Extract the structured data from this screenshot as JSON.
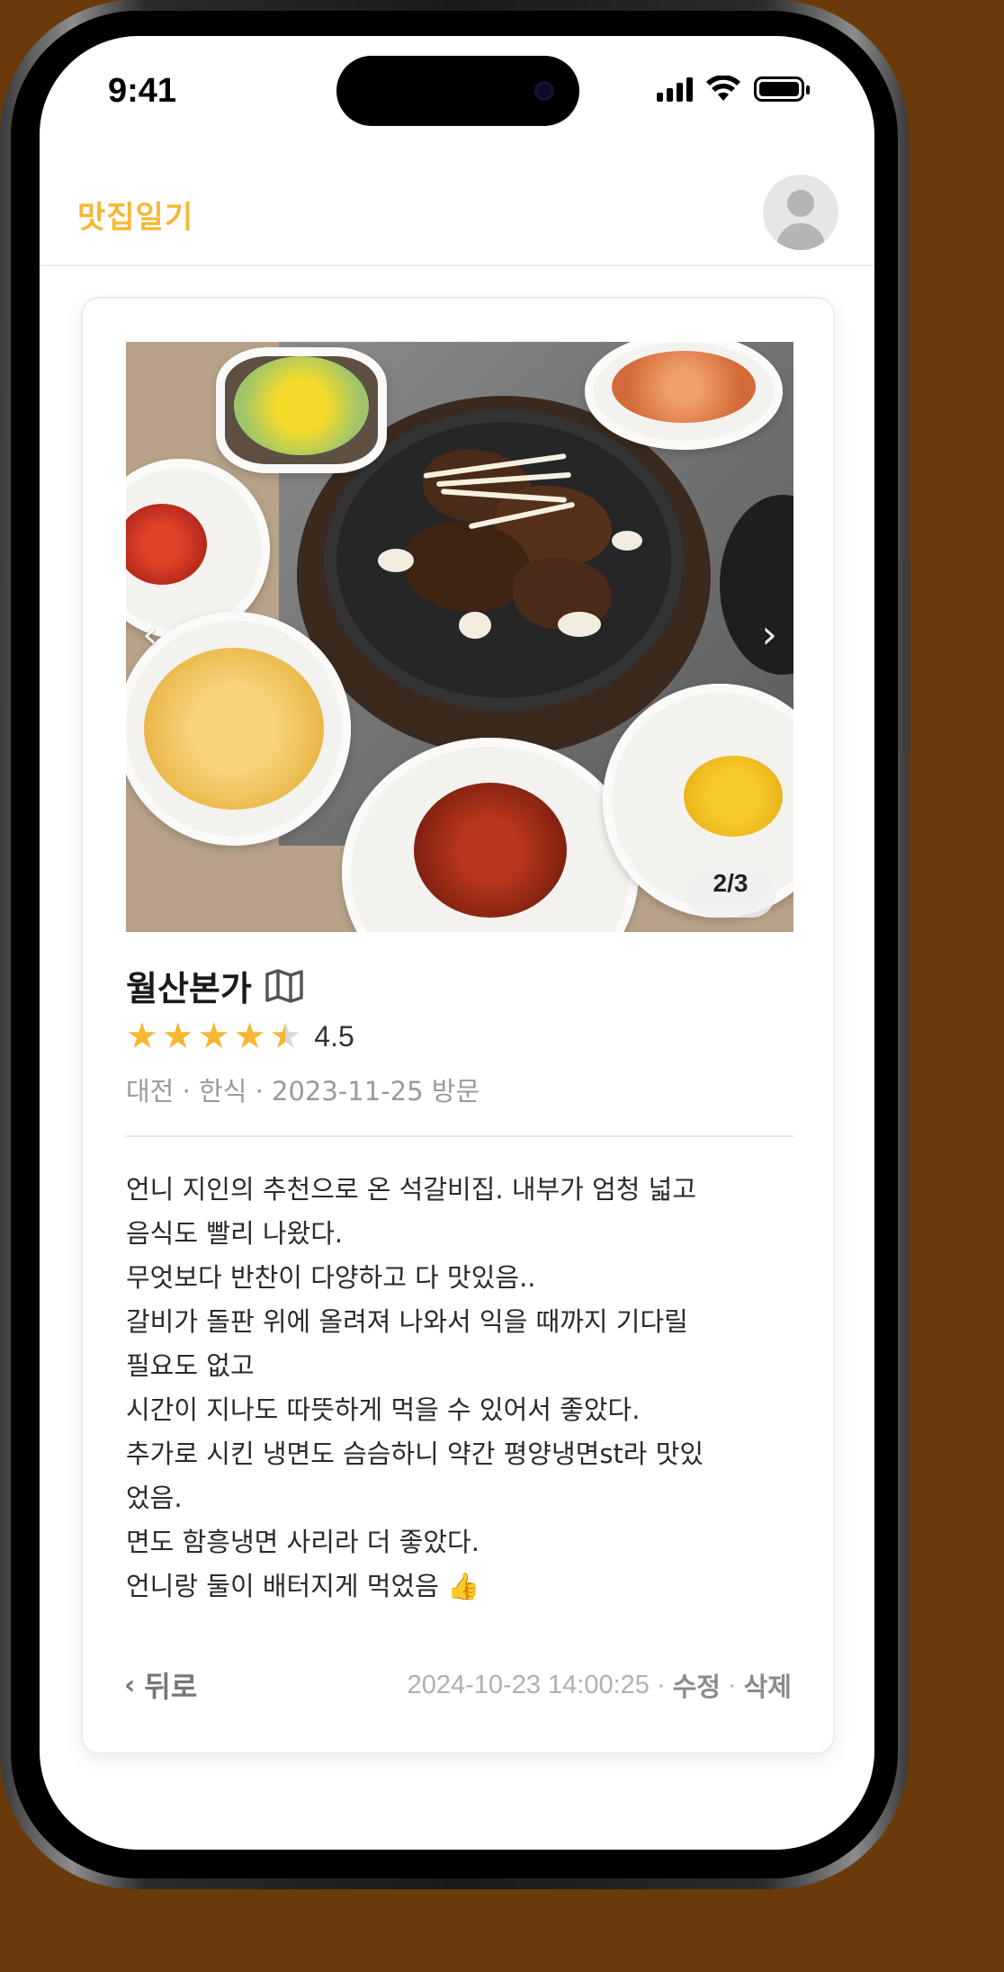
{
  "status_bar": {
    "time": "9:41"
  },
  "header": {
    "brand": "맛집일기"
  },
  "photo": {
    "counter": "2/3",
    "prev_icon": "chevron-left-icon",
    "next_icon": "chevron-right-icon"
  },
  "restaurant": {
    "name": "월산본가",
    "rating_value": "4.5",
    "rating": 4.5,
    "meta": "대전 · 한식 · 2023-11-25 방문"
  },
  "review_lines": [
    "언니 지인의 추천으로 온 석갈비집. 내부가 엄청 넓고",
    "음식도 빨리 나왔다.",
    "무엇보다 반찬이 다양하고 다 맛있음..",
    "갈비가 돌판 위에 올려져 나와서 익을 때까지 기다릴",
    "필요도 없고",
    "시간이 지나도 따뜻하게 먹을 수 있어서 좋았다.",
    "추가로 시킨 냉면도 슴슴하니 약간 평양냉면st라 맛있",
    "었음.",
    "면도 함흥냉면 사리라 더 좋았다.",
    "언니랑 둘이 배터지게 먹었음 👍"
  ],
  "footer": {
    "back_label": "뒤로",
    "timestamp": "2024-10-23 14:00:25",
    "separator": "·",
    "edit_label": "수정",
    "delete_label": "삭제"
  },
  "colors": {
    "brand": "#f7b731",
    "star": "#f7b731"
  }
}
